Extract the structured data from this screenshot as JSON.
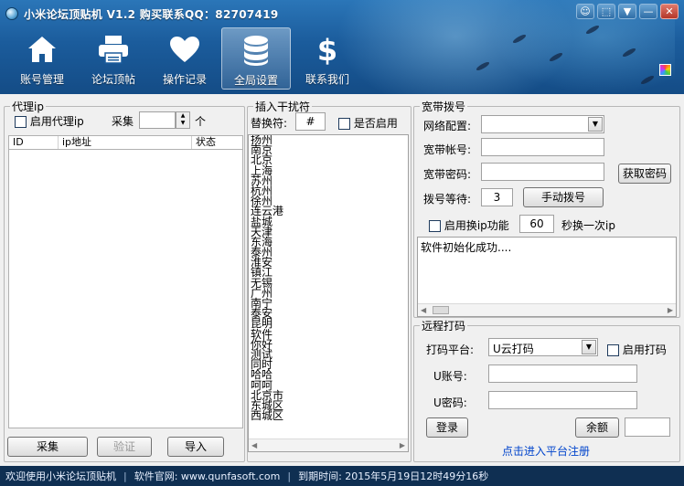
{
  "window": {
    "title": "小米论坛顶贴机 V1.2 购买联系QQ：82707419",
    "controls": [
      "☺",
      "⬚",
      "▼",
      "—",
      "✕"
    ]
  },
  "nav": {
    "items": [
      {
        "label": "账号管理",
        "icon": "home-icon"
      },
      {
        "label": "论坛顶帖",
        "icon": "printer-icon"
      },
      {
        "label": "操作记录",
        "icon": "heart-icon"
      },
      {
        "label": "全局设置",
        "icon": "database-icon",
        "active": true
      },
      {
        "label": "联系我们",
        "icon": "dollar-icon"
      }
    ]
  },
  "proxy": {
    "legend": "代理ip",
    "enable_label": "启用代理ip",
    "collect_label": "采集",
    "count_unit": "个",
    "count_value": "",
    "columns": [
      "ID",
      "ip地址",
      "状态"
    ],
    "buttons": {
      "collect": "采集",
      "verify": "验证",
      "import": "导入"
    }
  },
  "interference": {
    "legend": "插入干扰符",
    "replace_label": "替换符:",
    "replace_value": "#",
    "enable_label": "是否启用",
    "cities": [
      "扬州",
      "南京",
      "北京",
      "上海",
      "苏州",
      "杭州",
      "徐州",
      "连云港",
      "盐城",
      "天津",
      "东海",
      "泰州",
      "淮安",
      "镇江",
      "无锡",
      "广州",
      "南宁",
      "泰安",
      "昆明",
      "软件",
      "你好",
      "测试",
      "同时",
      "哈哈",
      "呵呵",
      "北京市",
      "东城区",
      "西城区"
    ]
  },
  "broadband": {
    "legend": "宽带拨号",
    "network_label": "网络配置:",
    "network_value": "",
    "account_label": "宽带帐号:",
    "account_value": "",
    "password_label": "宽带密码:",
    "password_value": "",
    "get_password_button": "获取密码",
    "dial_wait_label": "拨号等待:",
    "dial_wait_value": "3",
    "manual_dial_button": "手动拨号",
    "enable_ip_switch_label": "启用换ip功能",
    "switch_interval_value": "60",
    "switch_interval_suffix": "秒换一次ip",
    "log_text": "软件初始化成功...."
  },
  "captcha": {
    "legend": "远程打码",
    "platform_label": "打码平台:",
    "platform_value": "U云打码",
    "enable_label": "启用打码",
    "account_label": "U账号:",
    "account_value": "",
    "password_label": "U密码:",
    "password_value": "",
    "login_button": "登录",
    "balance_button": "余额",
    "balance_value": "",
    "register_link": "点击进入平台注册"
  },
  "status": {
    "welcome": "欢迎使用小米论坛顶贴机",
    "site": "软件官网: www.qunfasoft.com",
    "expiry": "到期时间: 2015年5月19日12时49分16秒"
  },
  "colors": {
    "header_top": "#2b76b8",
    "header_bottom": "#144c86",
    "status_bg": "#0f2f52",
    "link": "#0044cc"
  }
}
